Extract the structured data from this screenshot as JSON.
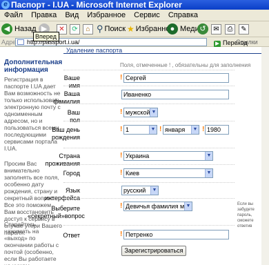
{
  "window": {
    "title": "Паспорт - I.UA  - Microsoft Internet Explorer"
  },
  "menu": [
    "Файл",
    "Правка",
    "Вид",
    "Избранное",
    "Сервис",
    "Справка"
  ],
  "toolbar": {
    "back": "Назад",
    "search": "Поиск",
    "favorites": "Избранное",
    "media": "Медиа"
  },
  "tooltip": "Вперед",
  "address": {
    "label": "Адрес",
    "url": "http://passport.i.ua/",
    "go": "Переход",
    "links": "Ссылки"
  },
  "page": {
    "top_link": "Удаление паспорта",
    "note": "Поля, отмеченные ! , обязательны для заполнения",
    "sidebar": {
      "title": "Дополнительная информация",
      "p1": "Регистрация в паспорте I.UA дает Вам возможность не только использовать электронную почту с одноименным адресом, но и пользоваться всеми последующими сервисами портала I.UA.",
      "p2": "Просим Вас внимательно заполнять все поля, особенно дату рождения, страну и секретный вопрос. Все это поможем Вам восстановить доступ к сервису в случае утери Вашего пароля.",
      "p3": "Старайтесь нажимать на «выход» по окончании работы с почтой (особенно, если Вы работаете на чужом компьютере)."
    },
    "form": {
      "name_label": "Ваше имя",
      "name_value": "Сергей",
      "surname_label": "Ваша фамилия",
      "surname_value": "Иваненко",
      "sex_label": "Ваш пол",
      "sex_value": "мужской",
      "birth_label": "Ваш день рождения",
      "birth_day": "1",
      "birth_month": "января",
      "birth_year": "1980",
      "country_label": "Страна проживания",
      "country_value": "Украина",
      "city_label": "Город",
      "city_value": "Киев",
      "lang_label": "Язык интерфейса",
      "lang_value": "русский",
      "question_label": "Выберите «секретный»вопрос",
      "question_value": "Девичья фамилия матери",
      "answer_label": "Ответ",
      "answer_value": "Петренко",
      "hint": "Если вы забудете пароль, сможете ответив",
      "submit": "Зарегистрироваться"
    }
  }
}
